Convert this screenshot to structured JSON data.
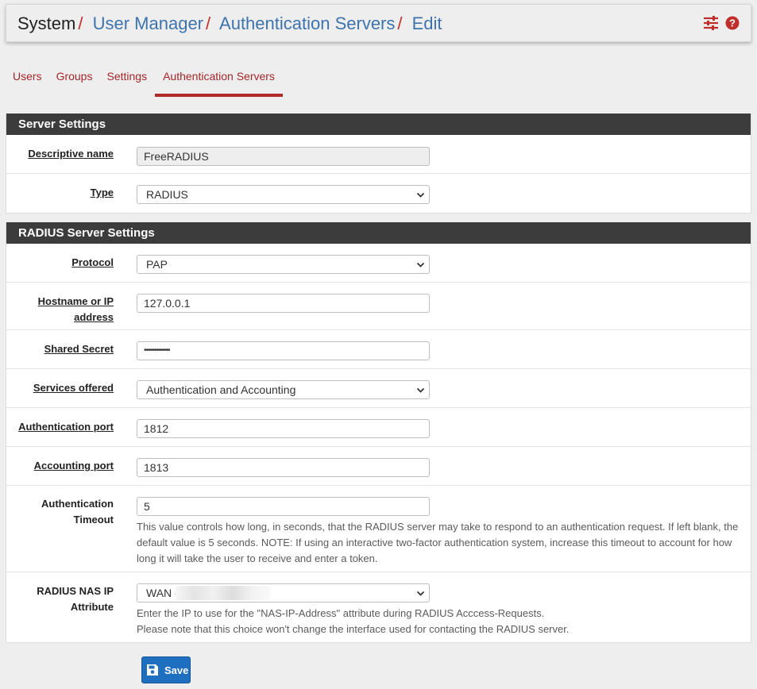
{
  "breadcrumb": {
    "root": "System",
    "items": [
      "User Manager",
      "Authentication Servers",
      "Edit"
    ],
    "separator": "/"
  },
  "header_icons": [
    "sliders-icon",
    "help-icon"
  ],
  "tabs": [
    {
      "label": "Users",
      "active": false
    },
    {
      "label": "Groups",
      "active": false
    },
    {
      "label": "Settings",
      "active": false
    },
    {
      "label": "Authentication Servers",
      "active": true
    }
  ],
  "server_settings": {
    "title": "Server Settings",
    "descriptive_name": {
      "label": "Descriptive name",
      "value": "FreeRADIUS"
    },
    "type": {
      "label": "Type",
      "value": "RADIUS"
    }
  },
  "radius_settings": {
    "title": "RADIUS Server Settings",
    "protocol": {
      "label": "Protocol",
      "value": "PAP"
    },
    "hostname": {
      "label_line1": "Hostname or IP",
      "label_line2": "address",
      "value": "127.0.0.1"
    },
    "shared_secret": {
      "label": "Shared Secret",
      "value": "•••••••••••••"
    },
    "services": {
      "label": "Services offered",
      "value": "Authentication and Accounting"
    },
    "auth_port": {
      "label": "Authentication port",
      "value": "1812"
    },
    "acct_port": {
      "label": "Accounting port",
      "value": "1813"
    },
    "timeout": {
      "label_line1": "Authentication",
      "label_line2": "Timeout",
      "value": "5",
      "help": "This value controls how long, in seconds, that the RADIUS server may take to respond to an authentication request. If left blank, the default value is 5 seconds. NOTE: If using an interactive two-factor authentication system, increase this timeout to account for how long it will take the user to receive and enter a token."
    },
    "nas_ip": {
      "label_line1": "RADIUS NAS IP",
      "label_line2": "Attribute",
      "value": "WAN -",
      "help_line1": "Enter the IP to use for the \"NAS-IP-Address\" attribute during RADIUS Acccess-Requests.",
      "help_line2": "Please note that this choice won't change the interface used for contacting the RADIUS server."
    }
  },
  "save_button": {
    "label": "Save"
  },
  "colors": {
    "link": "#3d74ad",
    "tab": "#a3282a",
    "accent": "#b12a2a",
    "panel_header": "#3c3c3c",
    "button": "#1e6fc0"
  }
}
